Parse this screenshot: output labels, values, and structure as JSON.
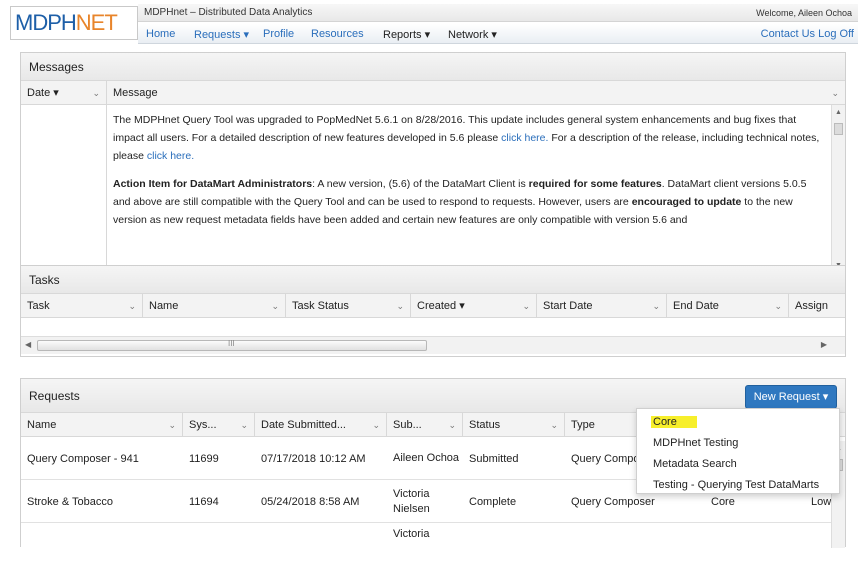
{
  "header": {
    "logo_part1": "MDPH",
    "logo_part2": "NET",
    "app_title": "MDPHnet – Distributed Data Analytics",
    "welcome": "Welcome, Aileen Ochoa",
    "nav": {
      "home": "Home",
      "requests": "Requests ▾",
      "profile": "Profile",
      "resources": "Resources",
      "reports": "Reports ▾",
      "network": "Network ▾",
      "contact": "Contact Us",
      "logoff": "Log Off"
    }
  },
  "messages": {
    "title": "Messages",
    "columns": {
      "date": "Date ▾",
      "message": "Message"
    },
    "p1_a": "The MDPHnet Query Tool was upgraded to PopMedNet 5.6.1 on 8/28/2016. This update includes general system enhancements and bug fixes that impact all users. For a detailed description of new features developed in 5.6 please ",
    "p1_link1": "click here.",
    "p1_b": " For a description of the release, including technical notes, please ",
    "p1_link2": "click here.",
    "p2_bold1": "Action Item for DataMart Administrators",
    "p2_a": ": A new version, (5.6) of the DataMart Client is ",
    "p2_bold2": "required for some features",
    "p2_b": ". DataMart client versions 5.0.5 and above are still compatible with the Query Tool and can be used to respond to requests. However, users are ",
    "p2_bold3": "encouraged to update",
    "p2_c": " to the new version as new request metadata fields have been added and certain new features are only compatible with version 5.6 and"
  },
  "tasks": {
    "title": "Tasks",
    "columns": [
      "Task",
      "Name",
      "Task Status",
      "Created ▾",
      "Start Date",
      "End Date",
      "Assign"
    ],
    "scroll_grip": "III"
  },
  "requests": {
    "title": "Requests",
    "new_request_label": "New Request ▾",
    "columns": [
      "Name",
      "Sys...",
      "Date Submitted...",
      "Sub...",
      "Status",
      "Type"
    ],
    "rows": [
      {
        "name": "Query Composer - 941",
        "sys": "11699",
        "date": "07/17/2018 10:12 AM",
        "sub": "Aileen Ochoa",
        "status": "Submitted",
        "type": "Query Compo",
        "project": "",
        "priority": ""
      },
      {
        "name": "Stroke & Tobacco",
        "sys": "11694",
        "date": "05/24/2018 8:58 AM",
        "sub": "Victoria Nielsen",
        "status": "Complete",
        "type": "Query Composer",
        "project": "Core",
        "priority": "Low"
      },
      {
        "name": "",
        "sys": "",
        "date": "",
        "sub": "Victoria",
        "status": "",
        "type": "",
        "project": "",
        "priority": ""
      }
    ]
  },
  "dropdown": {
    "items": [
      "Core",
      "MDPHnet Testing",
      "Metadata Search",
      "Testing - Querying Test DataMarts"
    ],
    "highlight_color": "#f7ef2b"
  },
  "colors": {
    "brand_blue": "#1d5fa8",
    "brand_orange": "#e8852b",
    "link": "#2a6ebb",
    "button": "#2f78c0"
  }
}
